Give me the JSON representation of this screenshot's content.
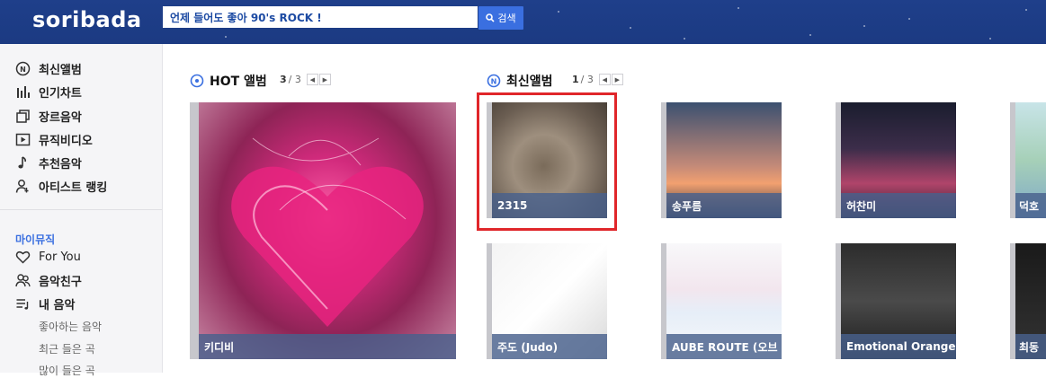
{
  "header": {
    "logo": "soribada",
    "search_value": "언제 들어도 좋아 90's ROCK !",
    "search_button": "검색"
  },
  "sidebar": {
    "items": [
      {
        "label": "최신앨범",
        "icon": "new-album-icon"
      },
      {
        "label": "인기차트",
        "icon": "chart-bars-icon"
      },
      {
        "label": "장르음악",
        "icon": "genre-icon"
      },
      {
        "label": "뮤직비디오",
        "icon": "video-play-icon"
      },
      {
        "label": "추천음악",
        "icon": "music-note-icon"
      },
      {
        "label": "아티스트 랭킹",
        "icon": "artist-icon"
      }
    ],
    "my_music_label": "마이뮤직",
    "my_items": [
      {
        "label": "For You",
        "icon": "heart-icon"
      },
      {
        "label": "음악친구",
        "icon": "friends-icon"
      },
      {
        "label": "내 음악",
        "icon": "playlist-icon"
      }
    ],
    "sub_items": [
      "좋아하는 음악",
      "최근 들은 곡",
      "많이 들은 곡"
    ]
  },
  "hot": {
    "title": "HOT 앨범",
    "page_current": "3",
    "page_total": "/ 3",
    "album": {
      "label": "키디비"
    }
  },
  "new": {
    "title": "최신앨범",
    "page_current": "1",
    "page_total": "/ 3",
    "albums": [
      {
        "label": "2315"
      },
      {
        "label": "송푸름"
      },
      {
        "label": "허찬미"
      },
      {
        "label": "덕호"
      },
      {
        "label": "주도 (Judo)"
      },
      {
        "label": "AUBE ROUTE (오브"
      },
      {
        "label": "Emotional Orange"
      },
      {
        "label": "최동"
      }
    ]
  },
  "colors": {
    "header_bg": "#1f3f8a",
    "accent": "#3a6fe0",
    "highlight": "#e0262a"
  }
}
